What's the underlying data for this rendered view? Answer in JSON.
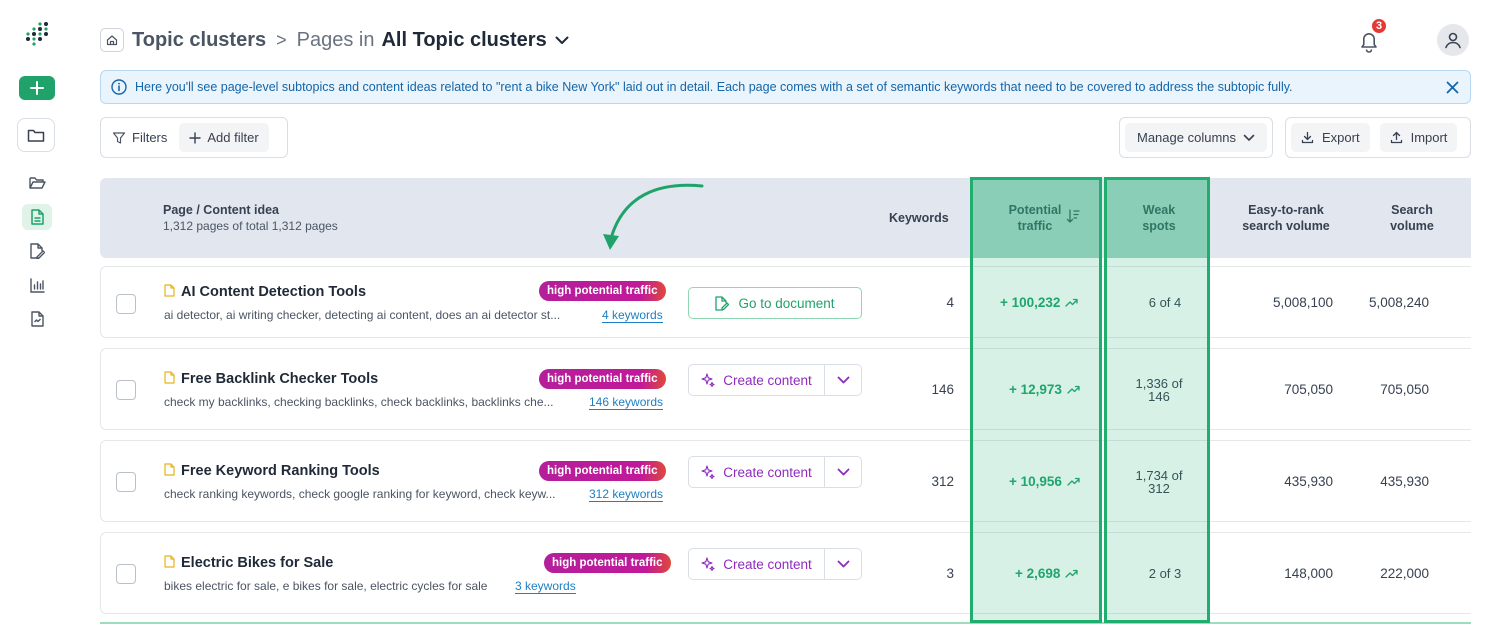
{
  "header": {
    "breadcrumb_root": "Topic clusters",
    "breadcrumb_separator": ">",
    "breadcrumb_pages_prefix": "Pages in",
    "breadcrumb_current": "All Topic clusters",
    "notification_count": "3"
  },
  "banner": {
    "text": "Here you'll see page-level subtopics and content ideas related to \"rent a bike New York\" laid out in detail. Each page comes with a set of semantic keywords that need to be covered to address the subtopic fully."
  },
  "toolbar": {
    "filters_label": "Filters",
    "add_filter_label": "Add filter",
    "manage_columns_label": "Manage columns",
    "export_label": "Export",
    "import_label": "Import"
  },
  "table": {
    "columns": {
      "page": "Page / Content idea",
      "page_sub": "1,312 pages of total 1,312 pages",
      "keywords": "Keywords",
      "traffic_line1": "Potential",
      "traffic_line2": "traffic",
      "weak_line1": "Weak",
      "weak_line2": "spots",
      "easy_line1": "Easy-to-rank",
      "easy_line2": "search volume",
      "search_line1": "Search",
      "search_line2": "volume"
    },
    "rows": [
      {
        "title": "AI Content Detection Tools",
        "badge": "high potential traffic",
        "desc": "ai detector, ai writing checker, detecting ai content, does an ai detector st...",
        "kw_link": "4 keywords",
        "action": "Go to document",
        "keywords": "4",
        "traffic": "+ 100,232",
        "weak_a": "6 of 4",
        "weak_b": "",
        "easy": "5,008,100",
        "search": "5,008,240"
      },
      {
        "title": "Free Backlink Checker Tools",
        "badge": "high potential traffic",
        "desc": "check my backlinks, checking backlinks, check backlinks, backlinks che...",
        "kw_link": "146 keywords",
        "action": "Create content",
        "keywords": "146",
        "traffic": "+ 12,973",
        "weak_a": "1,336 of",
        "weak_b": "146",
        "easy": "705,050",
        "search": "705,050"
      },
      {
        "title": "Free Keyword Ranking Tools",
        "badge": "high potential traffic",
        "desc": "check ranking keywords, check google ranking for keyword, check keyw...",
        "kw_link": "312 keywords",
        "action": "Create content",
        "keywords": "312",
        "traffic": "+ 10,956",
        "weak_a": "1,734 of",
        "weak_b": "312",
        "easy": "435,930",
        "search": "435,930"
      },
      {
        "title": "Electric Bikes for Sale",
        "badge": "high potential traffic",
        "desc": "bikes electric for sale, e bikes for sale, electric cycles for sale",
        "kw_link": "3 keywords",
        "action": "Create content",
        "keywords": "3",
        "traffic": "+ 2,698",
        "weak_a": "2 of 3",
        "weak_b": "",
        "easy": "148,000",
        "search": "222,000"
      }
    ]
  },
  "colors": {
    "brand_green": "#1fa36a",
    "highlight_border": "#1fae6e",
    "badge_gradient_start": "#b41f9a",
    "link_blue": "#1d7fc4",
    "create_purple": "#8e2bbd"
  },
  "icons": [
    "logo-icon",
    "plus-icon",
    "folder-icon",
    "folder-open-icon",
    "document-icon",
    "edit-document-icon",
    "chart-icon",
    "report-icon",
    "home-icon",
    "chevron-down-icon",
    "bell-icon",
    "user-icon",
    "info-icon",
    "close-icon",
    "filter-icon",
    "add-icon",
    "export-icon",
    "import-icon",
    "sort-icon",
    "trend-up-icon",
    "sparkle-icon",
    "go-document-icon",
    "arrow-annotation"
  ]
}
